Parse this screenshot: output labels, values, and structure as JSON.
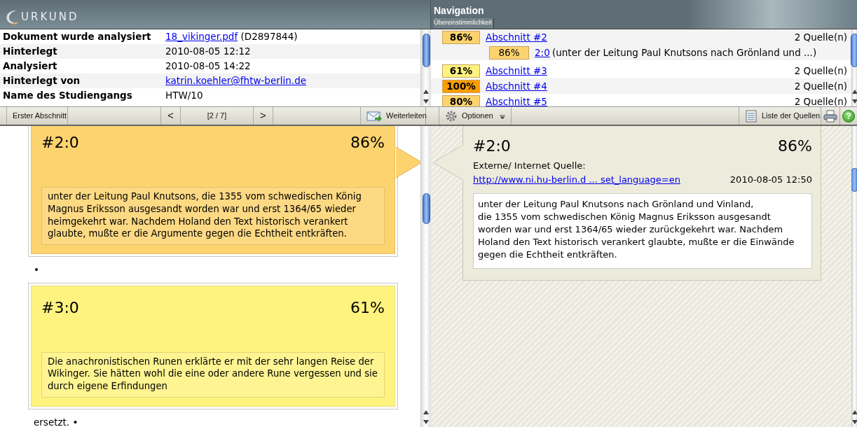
{
  "header": {
    "logo": "URKUND",
    "navigation_title": "Navigation",
    "tabs": [
      {
        "label": "Übereinstimmlichkeit",
        "selected": true
      }
    ]
  },
  "document_info": [
    {
      "label": "Dokument wurde analysiert",
      "value": "18_vikinger.pdf",
      "kind": "link",
      "suffix": "(D2897844)"
    },
    {
      "label": "Hinterlegt",
      "value": "2010-08-05 12:12",
      "kind": "text"
    },
    {
      "label": "Analysiert",
      "value": "2010-08-05 14:22",
      "kind": "text"
    },
    {
      "label": "Hinterlegt von",
      "value": "katrin.koehler@fhtw-berlin.de",
      "kind": "link"
    },
    {
      "label": "Name des Studiengangs",
      "value": "HTW/10",
      "kind": "text"
    }
  ],
  "navigation": [
    {
      "percent": "86%",
      "color": "#fdd36f",
      "label": "Abschnitt #2",
      "sources": "2 Quelle(n)",
      "children": [
        {
          "percent": "86%",
          "color": "#fdd36f",
          "label": "2:0",
          "excerpt": "(unter der Leitung Paul Knutsons nach Grönland und ...)"
        }
      ]
    },
    {
      "percent": "61%",
      "color": "#fef37f",
      "label": "Abschnitt #3",
      "sources": "2 Quelle(n)"
    },
    {
      "percent": "100%",
      "color": "#fb9d00",
      "label": "Abschnitt #4",
      "sources": "2 Quelle(n)"
    },
    {
      "percent": "80%",
      "color": "#fdd36f",
      "label": "Abschnitt #5",
      "sources": "2 Quelle(n)"
    }
  ],
  "toolbar": {
    "first_section": "Erster Abschnitt",
    "previous": "<",
    "page": "[2 / 7]",
    "next": ">",
    "forward": "Weiterleiten",
    "options": "Optionen",
    "source_list": "Liste der Quellen",
    "help": "?"
  },
  "document": [
    {
      "kind": "match",
      "id": "#2:0",
      "percent": "86%",
      "color": "#fdd36f",
      "text": "unter der Leitung Paul Knutsons, die 1355 vom schwedischen König Magnus Eriksson ausgesandt worden war und erst 1364/65 wieder heimgekehrt war. Nachdem Holand den Text historisch verankert glaubte, mußte er die Argumente gegen die Echtheit entkräften.",
      "selected": true
    },
    {
      "kind": "text",
      "text": "•"
    },
    {
      "kind": "match",
      "id": "#3:0",
      "percent": "61%",
      "color": "#fef37f",
      "text": "Die anachronistischen Runen erklärte er mit der sehr langen Reise der Wikinger. Sie hätten wohl die eine oder andere Rune vergessen und sie durch eigene Erfindungen",
      "selected": false
    },
    {
      "kind": "text",
      "text": "ersetzt. •"
    }
  ],
  "source": {
    "id": "#2:0",
    "percent": "86%",
    "source_label": "Externe/ Internet Quelle:",
    "link": "http://www.ni.hu-berlin.d ... set_language=en",
    "date": "2010-08-05 12:50",
    "text": "unter der Leitung Paul Knutsons nach Grönland und Vinland,\ndie 1355 vom schwedischen König Magnus Eriksson ausgesandt worden war und erst 1364/65 wieder zurückgekehrt war. Nachdem Holand den Text historisch verankert glaubte, mußte er die Einwände gegen die Echtheit entkräften."
  }
}
